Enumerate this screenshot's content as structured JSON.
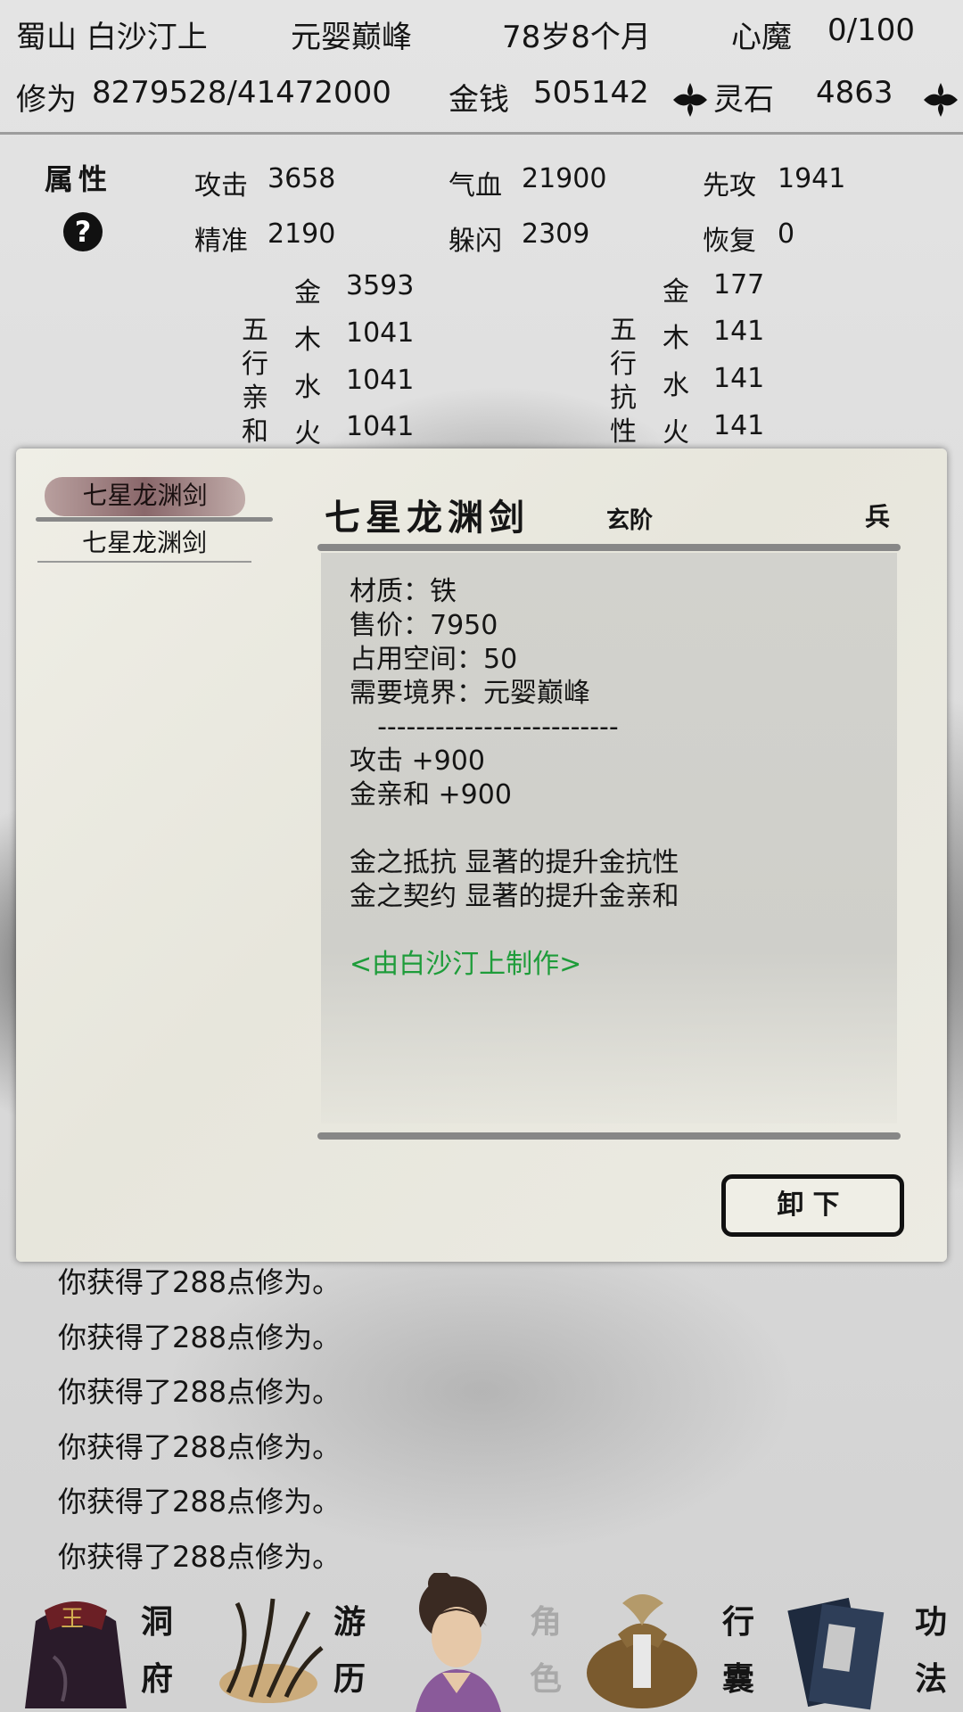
{
  "header": {
    "location": "蜀山 白沙汀上",
    "realm": "元婴巅峰",
    "age": "78岁8个月",
    "heart_demon_label": "心魔",
    "heart_demon_value": "0/100",
    "cultivation_label": "修为",
    "cultivation_value": "8279528/41472000",
    "money_label": "金钱",
    "money_value": "505142",
    "spirit_stone_label": "灵石",
    "spirit_stone_value": "4863"
  },
  "attributes": {
    "title": "属性",
    "stats": [
      {
        "label": "攻击",
        "value": "3658"
      },
      {
        "label": "气血",
        "value": "21900"
      },
      {
        "label": "先攻",
        "value": "1941"
      },
      {
        "label": "精准",
        "value": "2190"
      },
      {
        "label": "躲闪",
        "value": "2309"
      },
      {
        "label": "恢复",
        "value": "0"
      }
    ],
    "affinity_label": [
      "五",
      "行",
      "亲",
      "和"
    ],
    "affinity": [
      {
        "element": "金",
        "value": "3593"
      },
      {
        "element": "木",
        "value": "1041"
      },
      {
        "element": "水",
        "value": "1041"
      },
      {
        "element": "火",
        "value": "1041"
      }
    ],
    "resist_label": [
      "五",
      "行",
      "抗",
      "性"
    ],
    "resist": [
      {
        "element": "金",
        "value": "177"
      },
      {
        "element": "木",
        "value": "141"
      },
      {
        "element": "水",
        "value": "141"
      },
      {
        "element": "火",
        "value": "141"
      }
    ]
  },
  "modal": {
    "list_selected": "七星龙渊剑",
    "list_item": "七星龙渊剑",
    "item_name": "七星龙渊剑",
    "item_grade": "玄阶",
    "item_type": "兵",
    "details": [
      "材质：铁",
      "售价：7950",
      "占用空间：50",
      "需要境界：元婴巅峰",
      "  -------------------------",
      "攻击 +900",
      "金亲和 +900",
      "",
      "金之抵抗 显著的提升金抗性",
      "金之契约 显著的提升金亲和",
      ""
    ],
    "maker": "<由白沙汀上制作>",
    "unequip_button": "卸下"
  },
  "log": [
    "你获得了288点修为。",
    "你获得了288点修为。",
    "你获得了288点修为。",
    "你获得了288点修为。",
    "你获得了288点修为。",
    "你获得了288点修为。"
  ],
  "nav": {
    "items": [
      {
        "label": [
          "洞",
          "府"
        ],
        "icon": "cave-pouch-icon"
      },
      {
        "label": [
          "游",
          "历"
        ],
        "icon": "grass-travel-icon"
      },
      {
        "label": [
          "角",
          "色"
        ],
        "icon": "character-portrait-icon"
      },
      {
        "label": [
          "行",
          "囊"
        ],
        "icon": "bag-icon"
      },
      {
        "label": [
          "功",
          "法"
        ],
        "icon": "books-icon"
      }
    ]
  },
  "colors": {
    "maker_text": "#1e9c3a",
    "selected_item_bg": "#8a5c61",
    "dim_tab": "#a9a9a9"
  }
}
